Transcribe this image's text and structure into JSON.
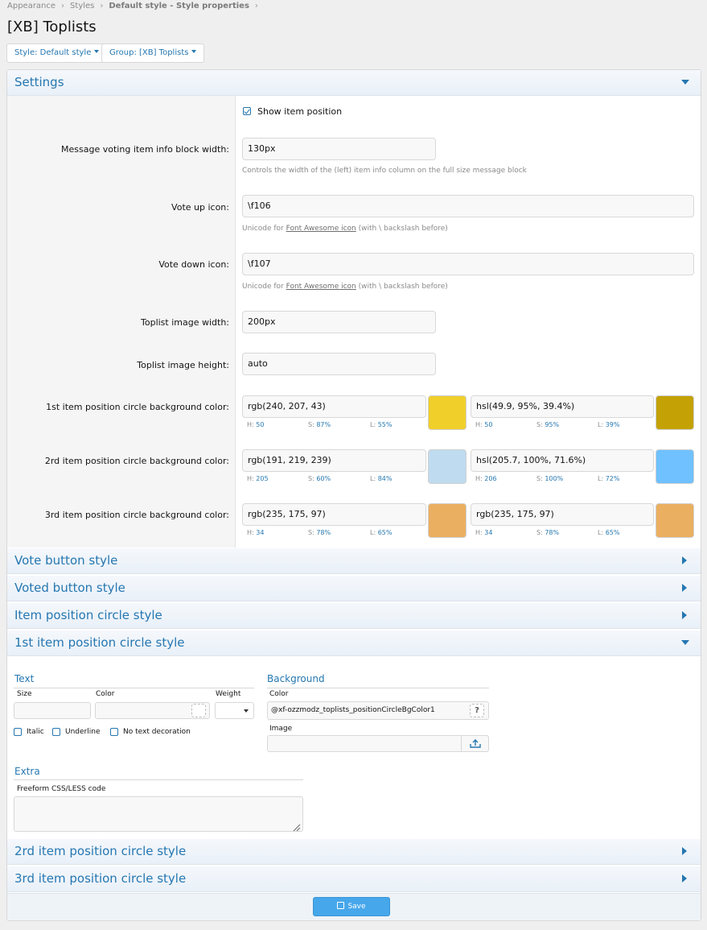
{
  "breadcrumb": [
    "Appearance",
    "Styles",
    "Default style - Style properties"
  ],
  "title": "[XB] Toplists",
  "style_selector": "Style: Default style",
  "group_selector": "Group: [XB] Toplists",
  "settings": {
    "header": "Settings",
    "show_item_position": "Show item position",
    "info_width": {
      "label": "Message voting item info block width:",
      "value": "130px",
      "hint": "Controls the width of the (left) item info column on the full size message block"
    },
    "vote_up": {
      "label": "Vote up icon:",
      "value": "\\f106",
      "hint_pre": "Unicode for ",
      "hint_link": "Font Awesome icon",
      "hint_post": " (with \\ backslash before)"
    },
    "vote_down": {
      "label": "Vote down icon:",
      "value": "\\f107",
      "hint_pre": "Unicode for ",
      "hint_link": "Font Awesome icon",
      "hint_post": " (with \\ backslash before)"
    },
    "image_width": {
      "label": "Toplist image width:",
      "value": "200px"
    },
    "image_height": {
      "label": "Toplist image height:",
      "value": "auto"
    },
    "color1": {
      "label": "1st item position circle background color:",
      "value": "rgb(240, 207, 43)",
      "swatch": "#f0cf2b",
      "h": "50",
      "s": "87%",
      "l": "55%",
      "value2": "hsl(49.9, 95%, 39.4%)",
      "swatch2": "#c4a205",
      "h2": "50",
      "s2": "95%",
      "l2": "39%"
    },
    "color2": {
      "label": "2rd item position circle background color:",
      "value": "rgb(191, 219, 239)",
      "swatch": "#bfdbef",
      "h": "205",
      "s": "60%",
      "l": "84%",
      "value2": "hsl(205.7, 100%, 71.6%)",
      "swatch2": "#6fc1ff",
      "h2": "206",
      "s2": "100%",
      "l2": "72%"
    },
    "color3": {
      "label": "3rd item position circle background color:",
      "value": "rgb(235, 175, 97)",
      "swatch": "#ebaf61",
      "h": "34",
      "s": "78%",
      "l": "65%",
      "value2": "rgb(235, 175, 97)",
      "swatch2": "#ebaf61",
      "h2": "34",
      "s2": "78%",
      "l2": "65%"
    },
    "hsl_h": "H:",
    "hsl_s": "S:",
    "hsl_l": "L:"
  },
  "sections": {
    "vote_button": "Vote button style",
    "voted_button": "Voted button style",
    "item_circle": "Item position circle style",
    "first_circle": "1st item position circle style",
    "second_circle": "2rd item position circle style",
    "third_circle": "3rd item position circle style"
  },
  "first_circle": {
    "text_header": "Text",
    "size_label": "Size",
    "color_label": "Color",
    "weight_label": "Weight",
    "italic": "Italic",
    "underline": "Underline",
    "no_decoration": "No text decoration",
    "background_header": "Background",
    "bg_color_label": "Color",
    "bg_color_value": "@xf-ozzmodz_toplists_positionCircleBgColor1",
    "help": "?",
    "image_label": "Image",
    "extra_header": "Extra",
    "css_label": "Freeform CSS/LESS code"
  },
  "save_label": "Save",
  "colors": {
    "accent": "#2577b1",
    "button": "#47a7eb"
  }
}
